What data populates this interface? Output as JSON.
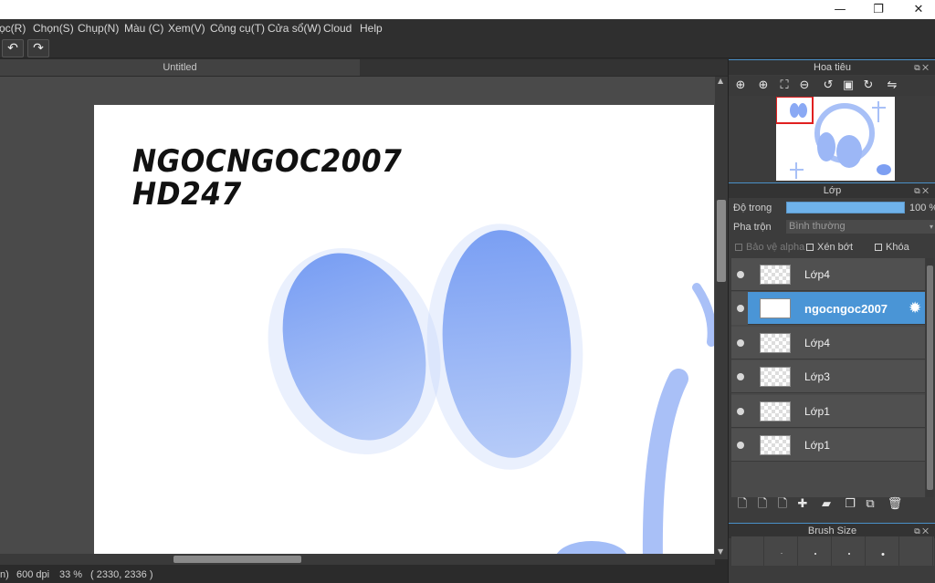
{
  "window": {
    "controls": [
      {
        "name": "minimize-button",
        "glyph": "—"
      },
      {
        "name": "restore-button",
        "glyph": "❐"
      },
      {
        "name": "close-button",
        "glyph": "✕"
      }
    ]
  },
  "menu": [
    "ọc(R)",
    "Chọn(S)",
    "Chụp(N)",
    "Màu (C)",
    "Xem(V)",
    "Công cụ(T)",
    "Cửa sổ(W)",
    "Cloud",
    "Help"
  ],
  "toolbar": {
    "undo_icon": "undo-icon",
    "redo_icon": "redo-icon",
    "undo_glyph": "↶",
    "redo_glyph": "↷"
  },
  "document": {
    "tab_title": "Untitled"
  },
  "canvas": {
    "text_lines": [
      "NGOCNGOC2007",
      "HD247"
    ],
    "paint_color": "#7fa3f5"
  },
  "status": {
    "prefix": "n)",
    "dpi": "600 dpi",
    "zoom": "33 %",
    "coords": "( 2330, 2336 )"
  },
  "navigator": {
    "title": "Hoa tiêu",
    "tools": [
      {
        "name": "zoom-actual-icon",
        "glyph": "⊕"
      },
      {
        "name": "zoom-in-icon",
        "glyph": "⊕"
      },
      {
        "name": "fit-window-icon",
        "glyph": "⛶"
      },
      {
        "name": "zoom-out-icon",
        "glyph": "⊖"
      },
      {
        "name": "rotate-left-icon",
        "glyph": "↺"
      },
      {
        "name": "fit-screen-icon",
        "glyph": "▣"
      },
      {
        "name": "rotate-right-icon",
        "glyph": "↻"
      },
      {
        "name": "flip-horizontal-icon",
        "glyph": "⇋"
      }
    ]
  },
  "layers_panel": {
    "title": "Lớp",
    "opacity_label": "Độ trong",
    "opacity_value": "100 %",
    "opacity": 1.0,
    "blend_label": "Pha trộn",
    "blend_value": "Bình thường",
    "protect_alpha": "Bảo vệ alpha",
    "clipping": "Xén bớt",
    "lock": "Khóa",
    "layers": [
      {
        "name": "Lớp4",
        "selected": false
      },
      {
        "name": "ngocngoc2007",
        "selected": true
      },
      {
        "name": "Lớp4",
        "selected": false
      },
      {
        "name": "Lớp3",
        "selected": false
      },
      {
        "name": "Lớp1",
        "selected": false
      },
      {
        "name": "Lớp1",
        "selected": false
      }
    ],
    "tools": [
      {
        "name": "new-layer-icon",
        "glyph": "🗋"
      },
      {
        "name": "new-layer-8bit-icon",
        "glyph": "🗋"
      },
      {
        "name": "new-layer-1bit-icon",
        "glyph": "🗋"
      },
      {
        "name": "add-layer-menu-icon",
        "glyph": "✚"
      },
      {
        "name": "new-folder-icon",
        "glyph": "▰"
      },
      {
        "name": "duplicate-layer-icon",
        "glyph": "❐"
      },
      {
        "name": "merge-layer-icon",
        "glyph": "⧉"
      },
      {
        "name": "delete-layer-icon",
        "glyph": "🗑"
      }
    ]
  },
  "brush_size_panel": {
    "title": "Brush Size",
    "sizes": [
      0,
      1,
      1.5,
      2,
      3,
      0
    ]
  }
}
